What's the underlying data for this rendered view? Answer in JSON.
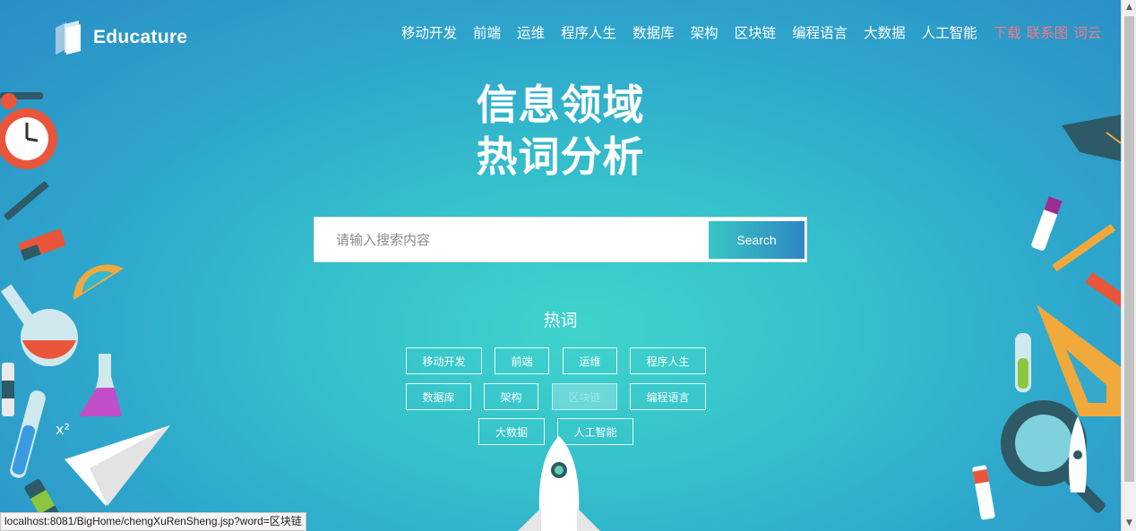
{
  "brand": {
    "name": "Educature"
  },
  "nav": {
    "items": [
      "移动开发",
      "前端",
      "运维",
      "程序人生",
      "数据库",
      "架构",
      "区块链",
      "编程语言",
      "大数据",
      "人工智能"
    ],
    "extra": [
      "下载",
      "联系图",
      "词云"
    ]
  },
  "headline": {
    "line1": "信息领域",
    "line2": "热词分析"
  },
  "search": {
    "placeholder": "请输入搜索内容",
    "value": "",
    "button_label": "Search"
  },
  "hot_words": {
    "title": "热词",
    "tags": [
      {
        "label": "移动开发",
        "active": false
      },
      {
        "label": "前端",
        "active": false
      },
      {
        "label": "运维",
        "active": false
      },
      {
        "label": "程序人生",
        "active": false
      },
      {
        "label": "数据库",
        "active": false
      },
      {
        "label": "架构",
        "active": false
      },
      {
        "label": "区块链",
        "active": true
      },
      {
        "label": "编程语言",
        "active": false
      },
      {
        "label": "大数据",
        "active": false
      },
      {
        "label": "人工智能",
        "active": false
      }
    ]
  },
  "status_bar": {
    "url": "localhost:8081/BigHome/chengXuRenSheng.jsp?word=区块链"
  },
  "colors": {
    "accent_link": "#f07b84",
    "bg_center": "#3fd3cc",
    "bg_edge": "#2b8ec6"
  }
}
